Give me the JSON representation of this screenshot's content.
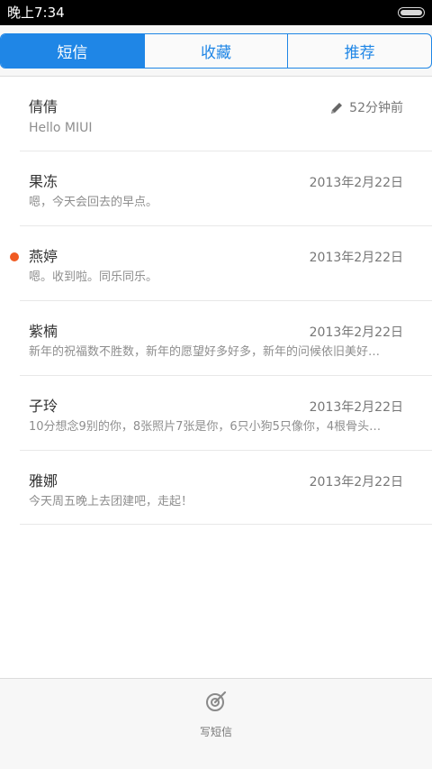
{
  "status": {
    "time": "晚上7:34",
    "battery_level": 1.0
  },
  "tabs": [
    {
      "label": "短信",
      "active": true
    },
    {
      "label": "收藏",
      "active": false
    },
    {
      "label": "推荐",
      "active": false
    }
  ],
  "conversations": [
    {
      "name": "倩倩",
      "preview": "Hello MIUI",
      "time": "52分钟前",
      "draft": true,
      "unread": false
    },
    {
      "name": "果冻",
      "preview": "嗯，今天会回去的早点。",
      "time": "2013年2月22日",
      "draft": false,
      "unread": false
    },
    {
      "name": "燕婷",
      "preview": "嗯。收到啦。同乐同乐。",
      "time": "2013年2月22日",
      "draft": false,
      "unread": true
    },
    {
      "name": "紫楠",
      "preview": "新年的祝福数不胜数，新年的愿望好多好多，新年的问候依旧美好…",
      "time": "2013年2月22日",
      "draft": false,
      "unread": false
    },
    {
      "name": "子玲",
      "preview": "10分想念9别的你，8张照片7张是你，6只小狗5只像你，4根骨头…",
      "time": "2013年2月22日",
      "draft": false,
      "unread": false
    },
    {
      "name": "雅娜",
      "preview": "今天周五晚上去团建吧，走起！",
      "time": "2013年2月22日",
      "draft": false,
      "unread": false
    }
  ],
  "bottom": {
    "compose_label": "写短信",
    "compose_icon": "compose-icon"
  },
  "colors": {
    "accent": "#1f86e6",
    "unread": "#f05a22"
  }
}
